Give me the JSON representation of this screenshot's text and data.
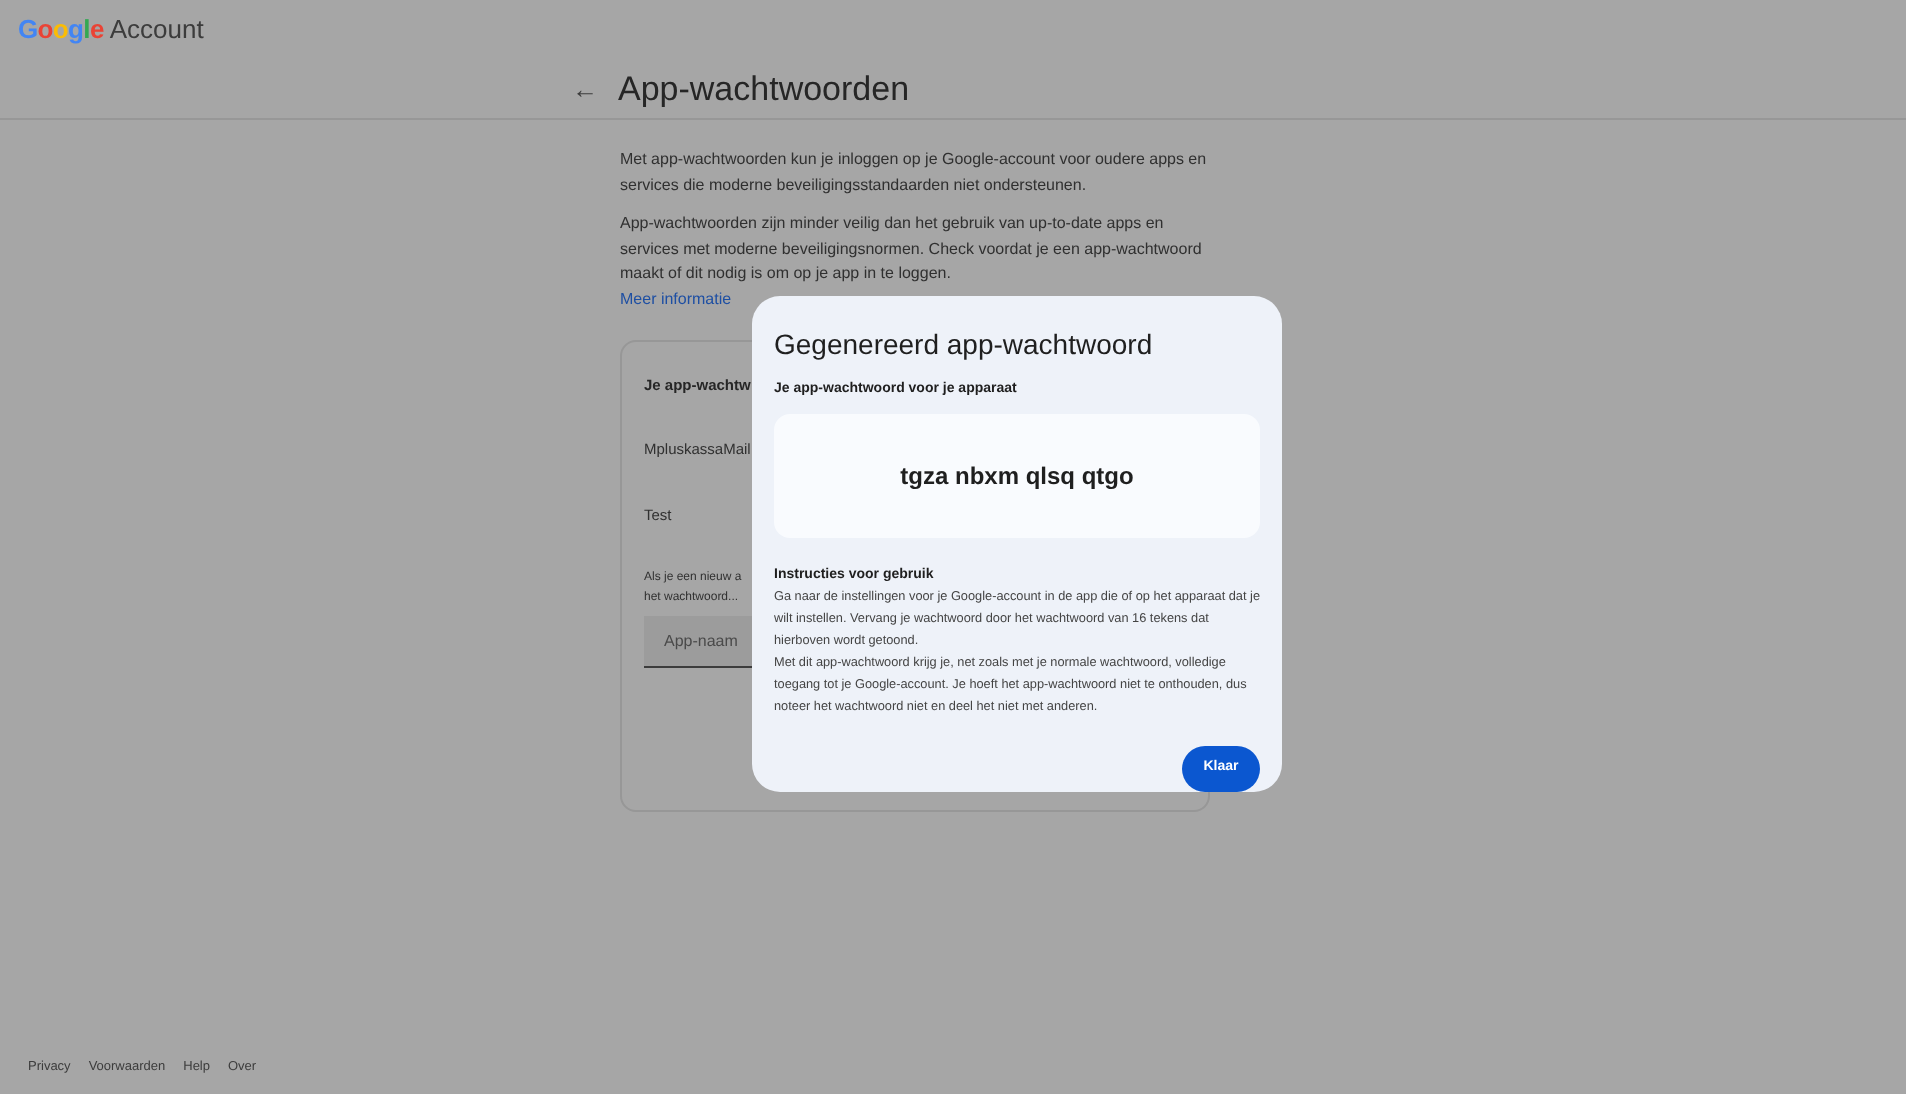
{
  "header": {
    "logo_letters": [
      {
        "text": "G",
        "color": "#4285f4"
      },
      {
        "text": "o",
        "color": "#ea4335"
      },
      {
        "text": "o",
        "color": "#fbbc05"
      },
      {
        "text": "g",
        "color": "#4285f4"
      },
      {
        "text": "l",
        "color": "#34a853"
      },
      {
        "text": "e",
        "color": "#ea4335"
      }
    ],
    "product": "Account"
  },
  "page": {
    "back": "←",
    "title": "App-wachtwoorden",
    "paragraphs": [
      "Met app-wachtwoorden kun je inloggen op je Google-account voor oudere apps en services die moderne beveiligingsstandaarden niet ondersteunen.",
      "App-wachtwoorden zijn minder veilig dan het gebruik van up-to-date apps en services met moderne beveiligingsnormen. Check voordat je een app-wachtwoord maakt of dit nodig is om op je app in te loggen."
    ],
    "link": "Meer informatie",
    "card": {
      "heading": "Je app-wachtw",
      "apps": [
        "MpluskassaMail",
        "Test"
      ],
      "hint_lines": [
        "Als je een nieuw a",
        "het wachtwoord..."
      ],
      "field": {
        "placeholder": "App-naam"
      }
    }
  },
  "dialog": {
    "title": "Gegenereerd app-wachtwoord",
    "subtitle": "Je app-wachtwoord voor je apparaat",
    "password": "tgza nbxm qlsq qtgo",
    "instructions_title": "Instructies voor gebruik",
    "instructions": [
      "Ga naar de instellingen voor je Google-account in de app die of op het apparaat dat je wilt instellen. Vervang je wachtwoord door het wachtwoord van 16 tekens dat hierboven wordt getoond.",
      "Met dit app-wachtwoord krijg je, net zoals met je normale wachtwoord, volledige toegang tot je Google-account. Je hoeft het app-wachtwoord niet te onthouden, dus noteer het wachtwoord niet en deel het niet met anderen."
    ],
    "button": "Klaar"
  },
  "footer": [
    "Privacy",
    "Voorwaarden",
    "Help",
    "Over"
  ]
}
